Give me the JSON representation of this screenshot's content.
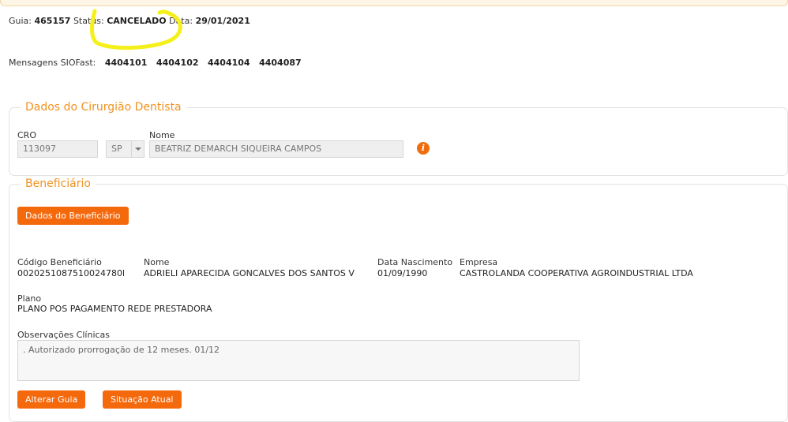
{
  "header": {
    "guia_label": "Guia:",
    "guia_value": "465157",
    "status_label": "Status:",
    "status_value": "CANCELADO",
    "data_label": "Data:",
    "data_value": "29/01/2021"
  },
  "mensagens": {
    "label": "Mensagens SIOFast:",
    "codes": [
      "4404101",
      "4404102",
      "4404104",
      "4404087"
    ]
  },
  "dentista": {
    "legend": "Dados do Cirurgião Dentista",
    "cro_label": "CRO",
    "cro_value": "113097",
    "uf_value": "SP",
    "nome_label": "Nome",
    "nome_value": "BEATRIZ DEMARCH SIQUEIRA CAMPOS",
    "info_icon": "info-icon"
  },
  "beneficiario": {
    "legend": "Beneficiário",
    "dados_button": "Dados do Beneficiário",
    "codigo_label": "Código Beneficiário",
    "codigo_value": "0020251087510024780l",
    "nome_label": "Nome",
    "nome_value": "ADRIELI APARECIDA GONCALVES DOS SANTOS V",
    "nascimento_label": "Data Nascimento",
    "nascimento_value": "01/09/1990",
    "empresa_label": "Empresa",
    "empresa_value": "CASTROLANDA COOPERATIVA AGROINDUSTRIAL LTDA",
    "plano_label": "Plano",
    "plano_value": "PLANO POS PAGAMENTO REDE PRESTADORA",
    "obs_label": "Observações Clínicas",
    "obs_value": ". Autorizado prorrogação de 12 meses. 01/12"
  },
  "actions": {
    "alterar": "Alterar Guia",
    "situacao": "Situação Atual"
  },
  "colors": {
    "accent": "#f5690d",
    "legend": "#f0921f",
    "highlight": "#f5f01a"
  }
}
